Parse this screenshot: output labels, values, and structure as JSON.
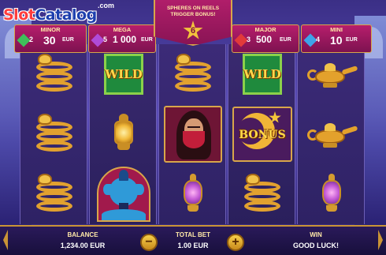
{
  "watermark": {
    "logo_slot": "Slot",
    "logo_catalog": "Catalog",
    "logo_com": ".com"
  },
  "banner": {
    "line1": "SPHERES ON REELS",
    "line2": "TRIGGER BONUS!",
    "count": "6"
  },
  "jackpots": [
    {
      "title": "MINOR",
      "count": "2",
      "value": "30",
      "currency": "EUR",
      "gem_color": "#3fc05a"
    },
    {
      "title": "MEGA",
      "count": "5",
      "value": "1 000",
      "currency": "EUR",
      "gem_color": "#b04bd8"
    },
    {
      "title": "MAJOR",
      "count": "3",
      "value": "500",
      "currency": "EUR",
      "gem_color": "#e23a3a"
    },
    {
      "title": "MINI",
      "count": "4",
      "value": "10",
      "currency": "EUR",
      "gem_color": "#3fa3e8"
    }
  ],
  "reels": [
    [
      "golden-snake",
      "golden-snake",
      "golden-snake"
    ],
    [
      "wild",
      "lantern",
      "genie"
    ],
    [
      "golden-snake",
      "masked-lady",
      "sphere-lantern"
    ],
    [
      "wild",
      "bonus",
      "golden-snake"
    ],
    [
      "magic-lamp",
      "magic-lamp",
      "sphere-lantern"
    ]
  ],
  "symbols": {
    "wild_text": "WILD",
    "bonus_text": "BONUS"
  },
  "footer": {
    "balance_label": "BALANCE",
    "balance_value": "1,234.00 EUR",
    "total_bet_label": "TOTAL BET",
    "total_bet_value": "1.00 EUR",
    "win_label": "WIN",
    "win_value": "GOOD LUCK!",
    "minus_label": "−",
    "plus_label": "+"
  },
  "colors": {
    "accent_gold": "#d8a64a",
    "panel_magenta": "#b01e6a",
    "background_purple": "#3b2f86"
  }
}
